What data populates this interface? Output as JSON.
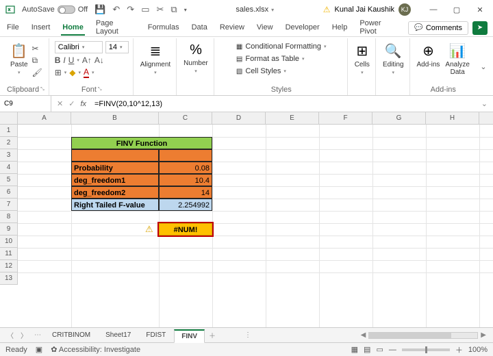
{
  "titlebar": {
    "autosave": "AutoSave",
    "off": "Off",
    "filename": "sales.xlsx",
    "user": "Kunal Jai Kaushik",
    "initials": "KJ"
  },
  "tabs": [
    "File",
    "Insert",
    "Home",
    "Page Layout",
    "Formulas",
    "Data",
    "Review",
    "View",
    "Developer",
    "Help",
    "Power Pivot"
  ],
  "active_tab": "Home",
  "comments_label": "Comments",
  "ribbon": {
    "clipboard": {
      "label": "Clipboard",
      "paste": "Paste"
    },
    "font": {
      "label": "Font",
      "name": "Calibri",
      "size": "14"
    },
    "alignment": {
      "label": "Alignment",
      "btn": "Alignment"
    },
    "number": {
      "label": "Number",
      "btn": "Number"
    },
    "styles": {
      "label": "Styles",
      "cf": "Conditional Formatting",
      "fat": "Format as Table",
      "cs": "Cell Styles"
    },
    "cells": {
      "label": "Cells",
      "btn": "Cells"
    },
    "editing": {
      "label": "Editing",
      "btn": "Editing"
    },
    "addins": {
      "btn": "Add-ins",
      "analyze": "Analyze\nData",
      "label": "Add-ins"
    }
  },
  "namebox": "C9",
  "formula": "=FINV(20,10^12,13)",
  "columns": [
    "A",
    "B",
    "C",
    "D",
    "E",
    "F",
    "G",
    "H"
  ],
  "rows": [
    "1",
    "2",
    "3",
    "4",
    "5",
    "6",
    "7",
    "8",
    "9",
    "10",
    "11",
    "12",
    "13"
  ],
  "cells": {
    "title": "FINV Function",
    "r4b": "Probability",
    "r4c": "0.08",
    "r5b": "deg_freedom1",
    "r5c": "10.4",
    "r6b": "deg_freedom2",
    "r6c": "14",
    "r7b": "Right Tailed F-value",
    "r7c": "2.254992",
    "r9c": "#NUM!"
  },
  "sheets": {
    "items": [
      "CRITBINOM",
      "Sheet17",
      "FDIST",
      "FINV"
    ],
    "active": "FINV"
  },
  "status": {
    "ready": "Ready",
    "acc": "Accessibility: Investigate",
    "zoom": "100%"
  }
}
